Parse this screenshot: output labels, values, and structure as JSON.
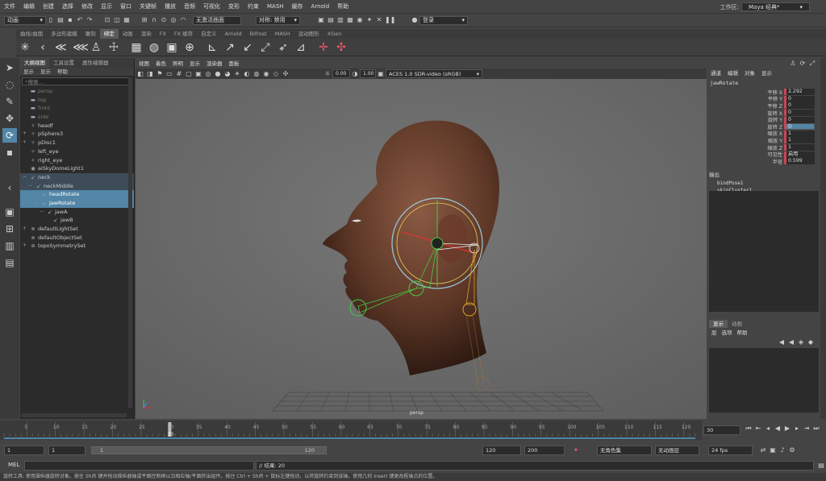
{
  "menubar": {
    "items": [
      "文件",
      "编辑",
      "创建",
      "选择",
      "修改",
      "显示",
      "窗口",
      "关键帧",
      "播放",
      "音频",
      "可视化",
      "变形",
      "约束",
      "MASH",
      "缓存",
      "Arnold",
      "帮助"
    ],
    "workspace_label": "工作区:",
    "workspace_value": "Maya 经典*"
  },
  "statusline": {
    "mode": "动画",
    "live_surface": "无激活曲面",
    "symmetry": "对称: 禁用",
    "login": "登录"
  },
  "shelf": {
    "tabs": [
      "曲线/曲面",
      "多边形建模",
      "雕刻",
      "绑定",
      "动画",
      "渲染",
      "FX",
      "FX 缓存",
      "自定义",
      "Arnold",
      "Bifrost",
      "MASH",
      "运动图形",
      "XGen"
    ],
    "active_tab": "绑定"
  },
  "outliner": {
    "tabs": [
      "大纲视图",
      "工具设置",
      "属性编辑器"
    ],
    "menu": [
      "显示",
      "显示",
      "帮助"
    ],
    "search_placeholder": "搜索...",
    "rows": [
      {
        "label": "persp",
        "indent": 0,
        "style": "dim",
        "icon": "camera-icon",
        "toggle": ""
      },
      {
        "label": "top",
        "indent": 0,
        "style": "dim",
        "icon": "camera-icon",
        "toggle": ""
      },
      {
        "label": "front",
        "indent": 0,
        "style": "dim",
        "icon": "camera-icon",
        "toggle": ""
      },
      {
        "label": "side",
        "indent": 0,
        "style": "dim",
        "icon": "camera-icon",
        "toggle": ""
      },
      {
        "label": "headf",
        "indent": 0,
        "style": "",
        "icon": "transform-icon",
        "toggle": ""
      },
      {
        "label": "pSphere3",
        "indent": 0,
        "style": "",
        "icon": "transform-icon",
        "toggle": "+"
      },
      {
        "label": "pDisc1",
        "indent": 0,
        "style": "",
        "icon": "transform-icon",
        "toggle": "+"
      },
      {
        "label": "left_eye",
        "indent": 0,
        "style": "",
        "icon": "transform-icon",
        "toggle": ""
      },
      {
        "label": "right_eye",
        "indent": 0,
        "style": "",
        "icon": "transform-icon",
        "toggle": ""
      },
      {
        "label": "aiSkyDomeLight1",
        "indent": 0,
        "style": "",
        "icon": "light-icon",
        "toggle": ""
      },
      {
        "label": "neck",
        "indent": 0,
        "style": "ph",
        "icon": "joint-icon",
        "toggle": "−"
      },
      {
        "label": "neckMiddle",
        "indent": 1,
        "style": "ph",
        "icon": "joint-icon",
        "toggle": "−"
      },
      {
        "label": "headRotate",
        "indent": 2,
        "style": "hl",
        "icon": "joint-icon",
        "toggle": ""
      },
      {
        "label": "jawRotate",
        "indent": 2,
        "style": "hl",
        "icon": "joint-icon",
        "toggle": "−"
      },
      {
        "label": "jawA",
        "indent": 3,
        "style": "",
        "icon": "joint-icon",
        "toggle": "−"
      },
      {
        "label": "jawB",
        "indent": 4,
        "style": "",
        "icon": "joint-icon",
        "toggle": ""
      },
      {
        "label": "defaultLightSet",
        "indent": 0,
        "style": "",
        "icon": "set-icon",
        "toggle": "+"
      },
      {
        "label": "defaultObjectSet",
        "indent": 0,
        "style": "",
        "icon": "set-icon",
        "toggle": ""
      },
      {
        "label": "topoSymmetrySet",
        "indent": 0,
        "style": "",
        "icon": "set-icon",
        "toggle": "+"
      }
    ]
  },
  "viewport": {
    "menu": [
      "视图",
      "着色",
      "照明",
      "显示",
      "渲染器",
      "面板"
    ],
    "exposure": "0.00",
    "gamma": "1.00",
    "colorspace": "ACES 1.0 SDR-video (sRGB)",
    "camera_label": "persp"
  },
  "channelbox": {
    "menu": [
      "通道",
      "编辑",
      "对象",
      "显示"
    ],
    "object_name": "jawRotate",
    "attributes": [
      {
        "name": "平移 X",
        "value": "2.292",
        "selected": false
      },
      {
        "name": "平移 Y",
        "value": "0",
        "selected": false
      },
      {
        "name": "平移 Z",
        "value": "0",
        "selected": false
      },
      {
        "name": "旋转 X",
        "value": "0",
        "selected": false
      },
      {
        "name": "旋转 Y",
        "value": "0",
        "selected": false
      },
      {
        "name": "旋转 Z",
        "value": "0",
        "selected": true
      },
      {
        "name": "缩放 X",
        "value": "1",
        "selected": false
      },
      {
        "name": "缩放 Y",
        "value": "1",
        "selected": false
      },
      {
        "name": "缩放 Z",
        "value": "1",
        "selected": false
      },
      {
        "name": "可见性",
        "value": "启用",
        "selected": false
      },
      {
        "name": "半径",
        "value": "0.599",
        "selected": false
      }
    ],
    "outputs_label": "输出",
    "outputs": [
      "bindPose1",
      "skinCluster1"
    ],
    "layer_tabs": [
      "显示",
      "动画"
    ],
    "layer_menu": [
      "层",
      "选项",
      "帮助"
    ]
  },
  "timeline": {
    "ticks": [
      "5",
      "10",
      "15",
      "20",
      "25",
      "30",
      "35",
      "40",
      "45",
      "50",
      "55",
      "60",
      "65",
      "70",
      "75",
      "80",
      "85",
      "90",
      "95",
      "100",
      "105",
      "110",
      "115",
      "120"
    ],
    "current_frame": "30",
    "current_frame_field": "30",
    "range_start": "1",
    "range_inner_start": "1",
    "range_slider_start": "1",
    "range_slider_end": "120",
    "range_inner_end": "120",
    "range_end": "200",
    "char_set": "无角色集",
    "anim_layer": "无动画层",
    "fps": "24 fps"
  },
  "cmdline": {
    "lang": "MEL",
    "result": "// 结果: 20"
  },
  "helpline": {
    "text": "旋转工具: 使用操纵器旋转对象。按住 Shift 键并拖动操纵器轴或平面控制柄以沿相应轴/平面挤出组件。按住 Ctrl + Shift + 鼠标左键拖动，以将旋转约束到该轴。使用几何 Insert 键更改枢轴点的位置。"
  }
}
